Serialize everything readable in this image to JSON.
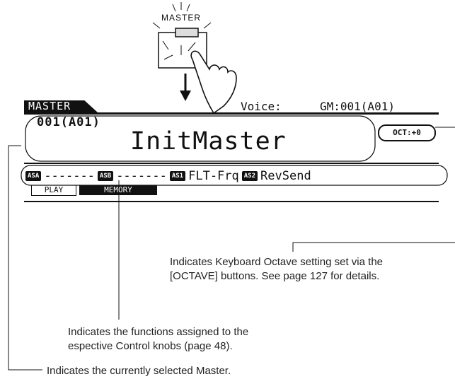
{
  "button": {
    "label": "MASTER"
  },
  "lcd": {
    "mode_title": "MASTER",
    "voice_label": "Voice:",
    "voice_value": "GM:001(A01)",
    "master_number": "001(A01)",
    "master_name": "InitMaster",
    "octave": "OCT:+0",
    "knob_assignments": [
      {
        "badge": "ASA",
        "value": "-------"
      },
      {
        "badge": "ASB",
        "value": "-------"
      },
      {
        "badge": "AS1",
        "value": "FLT-Frq"
      },
      {
        "badge": "AS2",
        "value": "RevSend"
      }
    ],
    "tabs": [
      {
        "label": "PLAY",
        "selected": false
      },
      {
        "label": "MEMORY",
        "selected": true
      }
    ]
  },
  "callouts": {
    "octave_line1": "Indicates Keyboard Octave setting set via the",
    "octave_line2": "[OCTAVE] buttons. See page 127 for details.",
    "knobs_line1": "Indicates the functions assigned to the",
    "knobs_line2": "espective Control knobs (page 48).",
    "master": "Indicates the currently selected Master."
  }
}
